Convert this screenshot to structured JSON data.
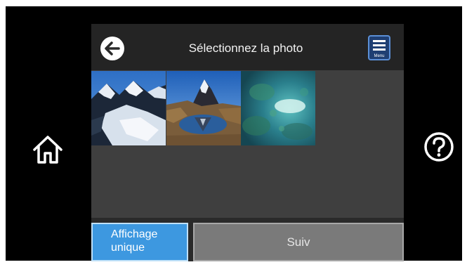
{
  "header": {
    "title": "Sélectionnez la photo",
    "menu_label": "Menu"
  },
  "icons": {
    "back": "back-arrow-icon",
    "menu": "menu-icon",
    "home": "home-icon",
    "help": "help-icon"
  },
  "photos": [
    "mountain glacier photo",
    "matterhorn lake photo",
    "underwater reef photo"
  ],
  "footer": {
    "single_view_label": "Affichage unique",
    "next_label": "Suiv"
  },
  "colors": {
    "accent": "#3d98e0",
    "screen_bg": "#3f3f3f",
    "header_bg": "#242424"
  }
}
